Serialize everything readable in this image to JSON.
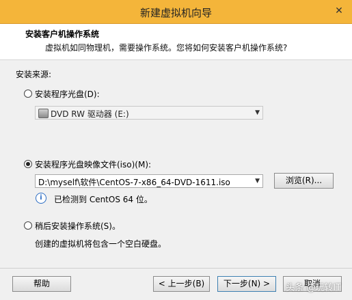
{
  "window": {
    "title": "新建虚拟机向导",
    "close": "✕"
  },
  "header": {
    "title": "安装客户机操作系统",
    "subtitle": "虚拟机如同物理机，需要操作系统。您将如何安装客户机操作系统?"
  },
  "source": {
    "label": "安装来源:",
    "options": [
      {
        "label": "安装程序光盘(D):",
        "selected": false,
        "value": "DVD RW 驱动器 (E:)"
      },
      {
        "label": "安装程序光盘映像文件(iso)(M):",
        "selected": true,
        "value": "D:\\myself\\软件\\CentOS-7-x86_64-DVD-1611.iso",
        "browse": "浏览(R)...",
        "detected": "已检测到 CentOS 64 位。"
      },
      {
        "label": "稍后安装操作系统(S)。",
        "selected": false,
        "note": "创建的虚拟机将包含一个空白硬盘。"
      }
    ]
  },
  "footer": {
    "help": "帮助",
    "back": "< 上一步(B)",
    "next": "下一步(N) >",
    "cancel": "取消"
  },
  "watermark": "头条 @玩转IT"
}
